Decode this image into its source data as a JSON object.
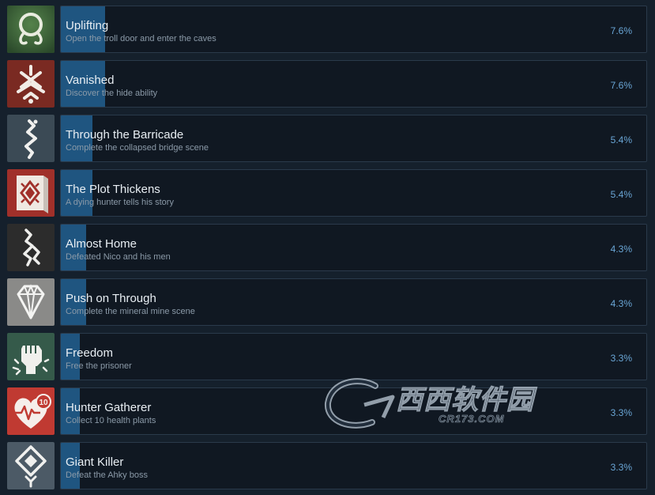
{
  "achievements": [
    {
      "title": "Uplifting",
      "description": "Open the troll door and enter the caves",
      "percent_label": "7.6%",
      "percent": 7.6,
      "icon": "ring-icon",
      "icon_bg": "#3f6a3a"
    },
    {
      "title": "Vanished",
      "description": "Discover the hide ability",
      "percent_label": "7.6%",
      "percent": 7.6,
      "icon": "rune-icon",
      "icon_bg": "#7a2a22"
    },
    {
      "title": "Through the Barricade",
      "description": "Complete the collapsed bridge scene",
      "percent_label": "5.4%",
      "percent": 5.4,
      "icon": "squiggle-icon",
      "icon_bg": "#3b4a55"
    },
    {
      "title": "The Plot Thickens",
      "description": "A dying hunter tells his story",
      "percent_label": "5.4%",
      "percent": 5.4,
      "icon": "tapestry-icon",
      "icon_bg": "#a0302a"
    },
    {
      "title": "Almost Home",
      "description": "Defeated Nico and his men",
      "percent_label": "4.3%",
      "percent": 4.3,
      "icon": "glyph-icon",
      "icon_bg": "#2c2c2c"
    },
    {
      "title": "Push on Through",
      "description": "Complete the mineral mine scene",
      "percent_label": "4.3%",
      "percent": 4.3,
      "icon": "diamond-icon",
      "icon_bg": "#8a8a88"
    },
    {
      "title": "Freedom",
      "description": "Free the prisoner",
      "percent_label": "3.3%",
      "percent": 3.3,
      "icon": "fist-icon",
      "icon_bg": "#355a4a"
    },
    {
      "title": "Hunter Gatherer",
      "description": "Collect 10 health plants",
      "percent_label": "3.3%",
      "percent": 3.3,
      "icon": "heart-icon",
      "icon_bg": "#c03a32",
      "icon_text": "10"
    },
    {
      "title": "Giant Killer",
      "description": "Defeat the Ahky boss",
      "percent_label": "3.3%",
      "percent": 3.3,
      "icon": "diamond-glyph-icon",
      "icon_bg": "#4c5a66"
    }
  ],
  "watermark": {
    "main": "西西软件园",
    "sub": "CR173.COM"
  },
  "colors": {
    "background": "#15202c",
    "panel": "#101822",
    "progress_fill": "#1f5580",
    "percent_text": "#6aa6d6"
  }
}
